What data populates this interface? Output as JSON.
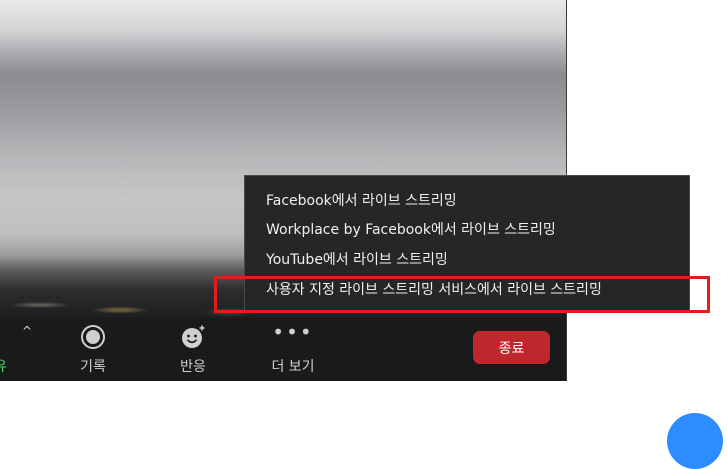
{
  "toolbar": {
    "share_label": "유",
    "caret": "^",
    "record_label": "기록",
    "reactions_label": "반응",
    "more_label": "더 보기",
    "more_dots": "•••",
    "end_label": "종료"
  },
  "live_menu": {
    "items": [
      "Facebook에서 라이브 스트리밍",
      "Workplace by Facebook에서 라이브 스트리밍",
      "YouTube에서 라이브 스트리밍",
      "사용자 지정 라이브 스트리밍 서비스에서 라이브 스트리밍"
    ]
  },
  "colors": {
    "end_button": "#c0272d",
    "highlight_box": "#e51c1c",
    "share_text": "#4cd964",
    "accent_blue": "#2d8cff"
  },
  "icons": {
    "record": "record-circle-icon",
    "reactions": "smiley-plus-icon",
    "more": "ellipsis-icon",
    "share_caret": "chevron-up-icon"
  }
}
